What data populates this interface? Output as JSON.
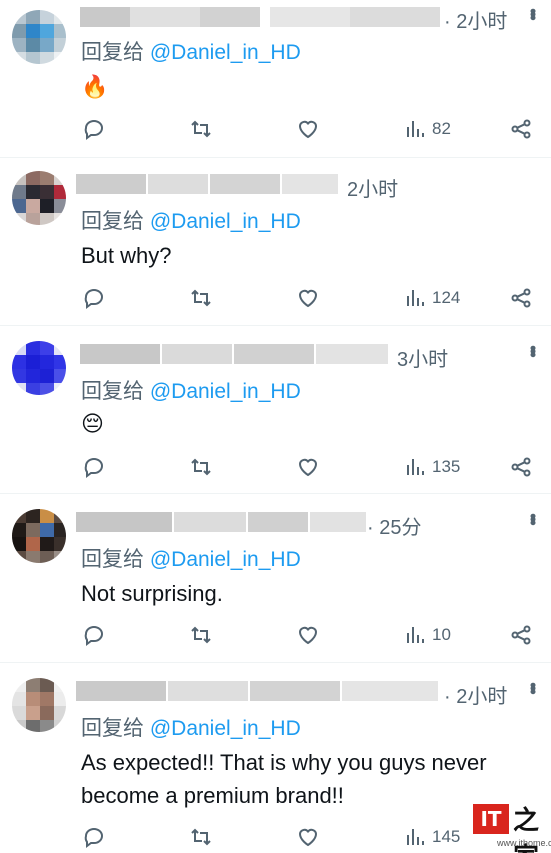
{
  "reply_prefix": "回复给",
  "mention": "@Daniel_in_HD",
  "icons": {
    "reply": "comment-icon",
    "retweet": "retweet-icon",
    "like": "heart-icon",
    "views": "views-icon",
    "share": "share-icon",
    "more": "more-icon"
  },
  "colors": {
    "link": "#1d9bf0",
    "muted": "#536471",
    "text": "#0f1419",
    "divider": "#eff3f4"
  },
  "replies": [
    {
      "time": "· 2小时",
      "text": "",
      "emoji": "🔥",
      "views": "82"
    },
    {
      "time": "2小时",
      "text": "But why?",
      "emoji": "",
      "views": "124"
    },
    {
      "time": "3小时",
      "text": "",
      "emoji": "😔",
      "views": "135"
    },
    {
      "time": "· 25分",
      "text": "Not surprising.",
      "emoji": "",
      "views": "10"
    },
    {
      "time": "· 2小时",
      "text": "As expected!! That is why you guys never become a premium brand!!",
      "emoji": "",
      "views": "145"
    }
  ],
  "watermark": {
    "badge": "IT",
    "chars": "之家",
    "url": "www.ithome.com"
  }
}
